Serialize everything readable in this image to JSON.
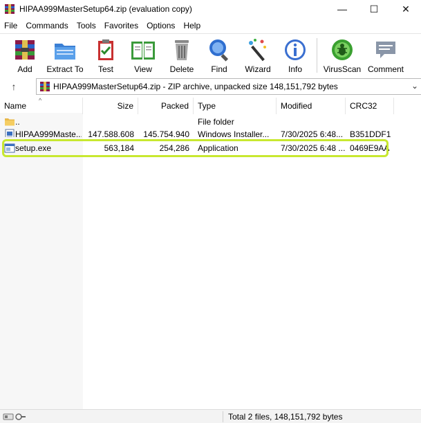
{
  "window": {
    "title": "HIPAA999MasterSetup64.zip (evaluation copy)",
    "controls": {
      "minimize": "—",
      "maximize": "☐",
      "close": "✕"
    }
  },
  "menu": [
    "File",
    "Commands",
    "Tools",
    "Favorites",
    "Options",
    "Help"
  ],
  "toolbar": [
    {
      "label": "Add",
      "icon": "add-archive-icon"
    },
    {
      "label": "Extract To",
      "icon": "extract-folder-icon"
    },
    {
      "label": "Test",
      "icon": "test-clipboard-icon"
    },
    {
      "label": "View",
      "icon": "view-book-icon"
    },
    {
      "label": "Delete",
      "icon": "trash-icon"
    },
    {
      "label": "Find",
      "icon": "magnifier-icon"
    },
    {
      "label": "Wizard",
      "icon": "magic-wand-icon"
    },
    {
      "label": "Info",
      "icon": "info-icon"
    },
    {
      "label": "VirusScan",
      "icon": "virus-scan-icon"
    },
    {
      "label": "Comment",
      "icon": "comment-icon"
    }
  ],
  "address": {
    "up_icon": "↑",
    "path": "HIPAA999MasterSetup64.zip - ZIP archive, unpacked size 148,151,792 bytes",
    "dropdown": "⌄"
  },
  "columns": [
    "Name",
    "Size",
    "Packed",
    "Type",
    "Modified",
    "CRC32"
  ],
  "sort_indicator": "^",
  "files": [
    {
      "name": "..",
      "size": "",
      "packed": "",
      "type": "File folder",
      "modified": "",
      "crc": "",
      "icon": "folder-icon"
    },
    {
      "name": "HIPAA999Maste...",
      "size": "147,588,608",
      "packed": "145,754,940",
      "type": "Windows Installer...",
      "modified": "7/30/2025 6:48...",
      "crc": "B351DDF1",
      "icon": "msi-installer-icon"
    },
    {
      "name": "setup.exe",
      "size": "563,184",
      "packed": "254,286",
      "type": "Application",
      "modified": "7/30/2025 6:48 ...",
      "crc": "0469E9AA",
      "icon": "exe-application-icon"
    }
  ],
  "status": {
    "text": "Total 2 files, 148,151,792 bytes"
  },
  "colors": {
    "highlight": "#c8e830"
  }
}
